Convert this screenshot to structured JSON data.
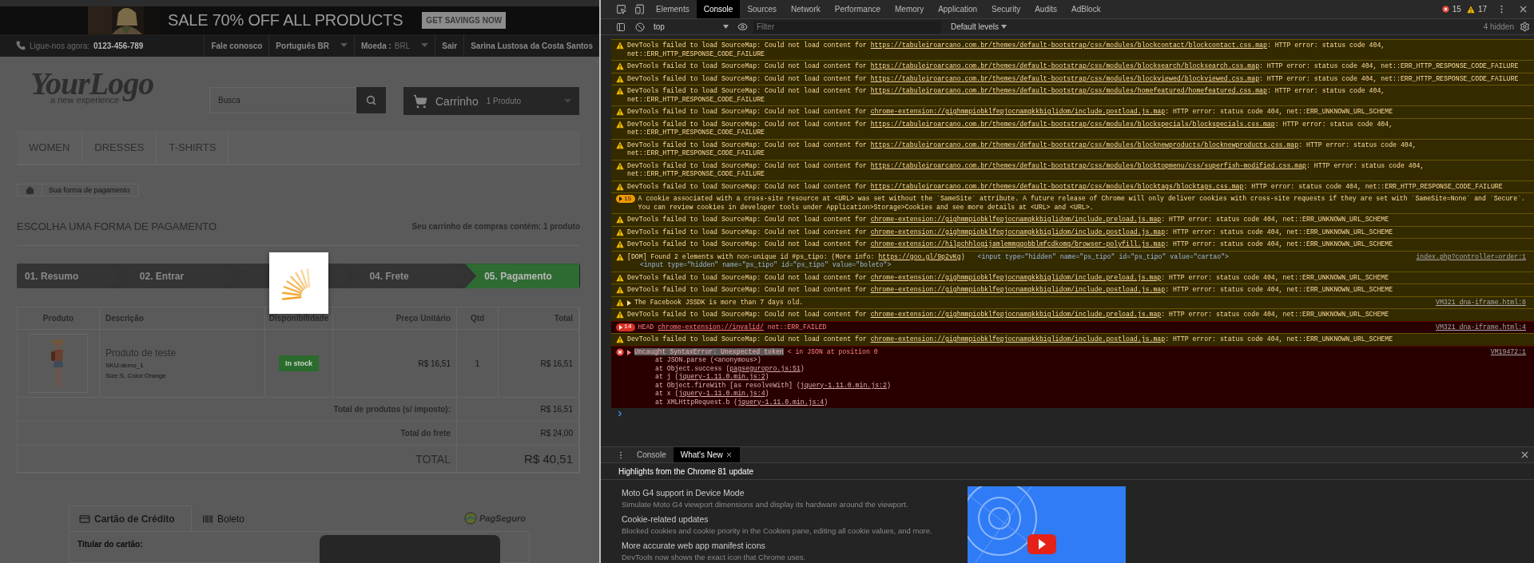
{
  "page": {
    "banner": {
      "headline": "SALE 70% OFF ALL PRODUCTS",
      "button": "GET SAVINGS NOW"
    },
    "top_nav": {
      "phone_label": "Ligue-nos agora:",
      "phone": "0123-456-789",
      "items": [
        {
          "label": "Fale conosco",
          "kind": "link"
        },
        {
          "label": "Português BR",
          "kind": "dropdown"
        },
        {
          "label": "Moeda :",
          "value": "BRL",
          "kind": "dropdown"
        },
        {
          "label": "Sair",
          "kind": "link"
        },
        {
          "label": "Sarina Lustosa da Costa Santos",
          "kind": "link"
        }
      ]
    },
    "logo": {
      "text": "YourLogo",
      "tagline": "a new experience"
    },
    "search": {
      "placeholder": "Busca"
    },
    "cart": {
      "label": "Carrinho",
      "count": "1 Produto"
    },
    "menu": [
      "WOMEN",
      "DRESSES",
      "T-SHIRTS"
    ],
    "breadcrumb": [
      "Sua forma de pagamento"
    ],
    "heading": "ESCOLHA UMA FORMA DE PAGAMENTO",
    "cart_summary": "Seu carrinho de compras contém: 1 produto",
    "steps": [
      {
        "label": "01. Resumo",
        "selected": false
      },
      {
        "label": "02. Entrar",
        "selected": false
      },
      {
        "selected": false
      },
      {
        "label": "04. Frete",
        "selected": false
      },
      {
        "label": "05. Pagamento",
        "selected": true
      }
    ],
    "loading": true,
    "table": {
      "columns": [
        "Produto",
        "Descrição",
        "Disponibilidade",
        "Preço Unitário",
        "Qtd",
        "Total"
      ],
      "rows": [
        {
          "name": "Produto de teste",
          "sku": "SKU:demo_1",
          "attributes": "Size:S, Color:Orange",
          "availability": "In stock",
          "price": "R$ 16,51",
          "qty": "1",
          "total": "R$ 16,51"
        }
      ],
      "totals": [
        {
          "label": "Total de produtos (s/ imposto):",
          "value": "R$ 16,51",
          "kind": "sub"
        },
        {
          "label": "Total do frete",
          "value": "R$ 24,00",
          "kind": "sub"
        },
        {
          "label": "TOTAL",
          "value": "R$ 40,51",
          "kind": "grand"
        }
      ]
    },
    "payment": {
      "tabs": [
        {
          "label": "Cartão de Crédito",
          "kind": "card",
          "selected": true
        },
        {
          "label": "Boleto",
          "kind": "barcode",
          "selected": false
        }
      ],
      "brand": "PagSeguro",
      "field_label": "Titular do cartão:"
    }
  },
  "devtools": {
    "tabs": [
      {
        "label": "Elements",
        "selected": false
      },
      {
        "label": "Console",
        "selected": true
      },
      {
        "label": "Sources",
        "selected": false
      },
      {
        "label": "Network",
        "selected": false
      },
      {
        "label": "Performance",
        "selected": false
      },
      {
        "label": "Memory",
        "selected": false
      },
      {
        "label": "Application",
        "selected": false
      },
      {
        "label": "Security",
        "selected": false
      },
      {
        "label": "Audits",
        "selected": false
      },
      {
        "label": "AdBlock",
        "selected": false
      }
    ],
    "error_count": "15",
    "warning_count": "17",
    "context": "top",
    "filter_placeholder": "Filter",
    "levels": "Default levels",
    "hidden": "4 hidden",
    "messages": [
      {
        "kind": "warning",
        "text": "DevTools failed to load SourceMap: Could not load content for ",
        "link": "https://tabuleiroarcano.com.br/themes/default-bootstrap/css/modules/blockcontact/blockcontact.css.map",
        "tail": ": HTTP error: status code 404, net::ERR_HTTP_RESPONSE_CODE_FAILURE"
      },
      {
        "kind": "warning",
        "text": "DevTools failed to load SourceMap: Could not load content for ",
        "link": "https://tabuleiroarcano.com.br/themes/default-bootstrap/css/modules/blocksearch/blocksearch.css.map",
        "tail": ": HTTP error: status code 404, net::ERR_HTTP_RESPONSE_CODE_FAILURE"
      },
      {
        "kind": "warning",
        "text": "DevTools failed to load SourceMap: Could not load content for ",
        "link": "https://tabuleiroarcano.com.br/themes/default-bootstrap/css/modules/blockviewed/blockviewed.css.map",
        "tail": ": HTTP error: status code 404, net::ERR_HTTP_RESPONSE_CODE_FAILURE"
      },
      {
        "kind": "warning",
        "text": "DevTools failed to load SourceMap: Could not load content for ",
        "link": "https://tabuleiroarcano.com.br/themes/default-bootstrap/css/modules/homefeatured/homefeatured.css.map",
        "tail": ": HTTP error: status code 404, net::ERR_HTTP_RESPONSE_CODE_FAILURE"
      },
      {
        "kind": "warning",
        "text": "DevTools failed to load SourceMap: Could not load content for ",
        "link": "chrome-extension://gighmmpiobklfepjocnamgkkbiglidom/include.postload.js.map",
        "tail": ": HTTP error: status code 404, net::ERR_UNKNOWN_URL_SCHEME"
      },
      {
        "kind": "warning",
        "text": "DevTools failed to load SourceMap: Could not load content for ",
        "link": "https://tabuleiroarcano.com.br/themes/default-bootstrap/css/modules/blockspecials/blockspecials.css.map",
        "tail": ": HTTP error: status code 404, net::ERR_HTTP_RESPONSE_CODE_FAILURE"
      },
      {
        "kind": "warning",
        "text": "DevTools failed to load SourceMap: Could not load content for ",
        "link": "https://tabuleiroarcano.com.br/themes/default-bootstrap/css/modules/blocknewproducts/blocknewproducts.css.map",
        "tail": ": HTTP error: status code 404, net::ERR_HTTP_RESPONSE_CODE_FAILURE"
      },
      {
        "kind": "warning",
        "text": "DevTools failed to load SourceMap: Could not load content for ",
        "link": "https://tabuleiroarcano.com.br/themes/default-bootstrap/css/modules/blocktopmenu/css/superfish-modified.css.map",
        "tail": ": HTTP error: status code 404, net::ERR_HTTP_RESPONSE_CODE_FAILURE"
      },
      {
        "kind": "warning",
        "text": "DevTools failed to load SourceMap: Could not load content for ",
        "link": "https://tabuleiroarcano.com.br/themes/default-bootstrap/css/modules/blocktags/blocktags.css.map",
        "tail": ": HTTP error: status code 404, net::ERR_HTTP_RESPONSE_CODE_FAILURE"
      },
      {
        "kind": "warning",
        "count": "15",
        "expandable": true,
        "text": "A cookie associated with a cross-site resource at <URL> was set without the `SameSite` attribute. A future release of Chrome will only deliver cookies with cross-site requests if they are set with `SameSite=None` and `Secure`. You can review cookies in developer tools under Application>Storage>Cookies and see more details at <URL> and <URL>."
      },
      {
        "kind": "warning",
        "text": "DevTools failed to load SourceMap: Could not load content for ",
        "link": "chrome-extension://gighmmpiobklfepjocnamgkkbiglidom/include.preload.js.map",
        "tail": ": HTTP error: status code 404, net::ERR_UNKNOWN_URL_SCHEME"
      },
      {
        "kind": "warning",
        "text": "DevTools failed to load SourceMap: Could not load content for ",
        "link": "chrome-extension://gighmmpiobklfepjocnamgkkbiglidom/include.postload.js.map",
        "tail": ": HTTP error: status code 404, net::ERR_UNKNOWN_URL_SCHEME"
      },
      {
        "kind": "warning",
        "text": "DevTools failed to load SourceMap: Could not load content for ",
        "link": "chrome-extension://hilpchhlogijamlemmggobblmfcdkomg/browser-polyfill.js.map",
        "tail": ": HTTP error: status code 404, net::ERR_UNKNOWN_URL_SCHEME"
      },
      {
        "kind": "warning",
        "text": "[DOM] Found 2 elements with non-unique id #ps_tipo: (More info: ",
        "link": "https://goo.gl/9p2vKg",
        "tail": ")",
        "snippets": [
          "<input type=\"hidden\" name=\"ps_tipo\" id=\"ps_tipo\" value=\"cartao\">",
          "<input type=\"hidden\" name=\"ps_tipo\" id=\"ps_tipo\" value=\"boleto\">"
        ],
        "source": "index.php?controller=order:1"
      },
      {
        "kind": "warning",
        "text": "DevTools failed to load SourceMap: Could not load content for ",
        "link": "chrome-extension://gighmmpiobklfepjocnamgkkbiglidom/include.preload.js.map",
        "tail": ": HTTP error: status code 404, net::ERR_UNKNOWN_URL_SCHEME"
      },
      {
        "kind": "warning",
        "text": "DevTools failed to load SourceMap: Could not load content for ",
        "link": "chrome-extension://gighmmpiobklfepjocnamgkkbiglidom/include.postload.js.map",
        "tail": ": HTTP error: status code 404, net::ERR_UNKNOWN_URL_SCHEME"
      },
      {
        "kind": "warning",
        "expandable": true,
        "text": "The Facebook JSSDK is more than 7 days old.",
        "source": "VM321 dna-iframe.html:8"
      },
      {
        "kind": "warning",
        "text": "DevTools failed to load SourceMap: Could not load content for ",
        "link": "chrome-extension://gighmmpiobklfepjocnamgkkbiglidom/include.preload.js.map",
        "tail": ": HTTP error: status code 404, net::ERR_UNKNOWN_URL_SCHEME"
      },
      {
        "kind": "error",
        "count": "14",
        "expandable": true,
        "text": "HEAD ",
        "link": "chrome-extension://invalid/",
        "tail": " net::ERR_FAILED",
        "source": "VM321 dna-iframe.html:4"
      },
      {
        "kind": "warning",
        "text": "DevTools failed to load SourceMap: Could not load content for ",
        "link": "chrome-extension://gighmmpiobklfepjocnamgkkbiglidom/include.postload.js.map",
        "tail": ": HTTP error: status code 404, net::ERR_UNKNOWN_URL_SCHEME"
      },
      {
        "kind": "error",
        "expandable": true,
        "marked": "Uncaught SyntaxError: Unexpected token",
        "text": " < in JSON at position 0",
        "source": "VM19472:1",
        "stack": [
          {
            "text": "at JSON.parse (<anonymous>)"
          },
          {
            "text": "at Object.success (",
            "link": "pagseguropro.js:51",
            "tail": ")"
          },
          {
            "text": "at j (",
            "link": "jquery-1.11.0.min.js:2",
            "tail": ")"
          },
          {
            "text": "at Object.fireWith [as resolveWith] (",
            "link": "jquery-1.11.0.min.js:2",
            "tail": ")"
          },
          {
            "text": "at x (",
            "link": "jquery-1.11.0.min.js:4",
            "tail": ")"
          },
          {
            "text": "at XMLHttpRequest.b (",
            "link": "jquery-1.11.0.min.js:4",
            "tail": ")"
          }
        ]
      }
    ],
    "drawer": {
      "tabs": [
        {
          "label": "Console",
          "selected": false,
          "closable": false
        },
        {
          "label": "What's New",
          "selected": true,
          "closable": true
        }
      ],
      "header": "Highlights from the Chrome 81 update",
      "items": [
        {
          "title": "Moto G4 support in Device Mode",
          "description": "Simulate Moto G4 viewport dimensions and display its hardware around the viewport."
        },
        {
          "title": "Cookie-related updates",
          "description": "Blocked cookies and cookie priority in the Cookies pane, editing all cookie values, and more."
        },
        {
          "title": "More accurate web app manifest icons",
          "description": "DevTools now shows the exact icon that Chrome uses."
        }
      ]
    }
  }
}
